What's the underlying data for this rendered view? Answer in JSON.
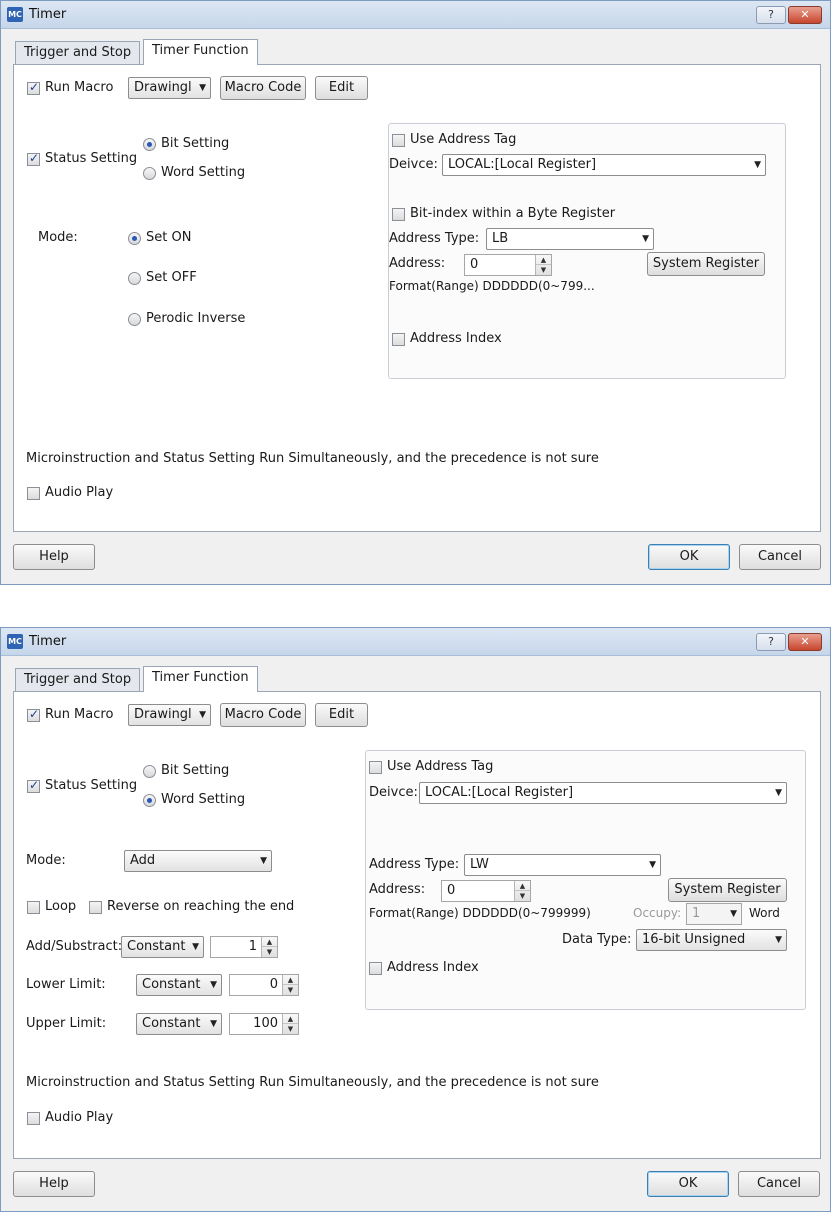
{
  "dialog1": {
    "title": "Timer",
    "help_caption": "?",
    "close_caption": "✕",
    "tabs": [
      "Trigger and Stop",
      "Timer Function"
    ],
    "run_macro": {
      "label": "Run Macro",
      "checked": true,
      "combo": "Drawingl",
      "macro_code": "Macro Code",
      "edit": "Edit"
    },
    "status_setting": {
      "label": "Status Setting",
      "checked": true
    },
    "bit_setting": "Bit Setting",
    "word_setting": "Word Setting",
    "mode_label": "Mode:",
    "modes": [
      "Set ON",
      "Set OFF",
      "Perodic Inverse"
    ],
    "address": {
      "use_address_tag": "Use Address Tag",
      "device_label": "Deivce:",
      "device_value": "LOCAL:[Local Register]",
      "bit_index": "Bit-index within a Byte Register",
      "address_type_label": "Address Type:",
      "address_type_value": "LB",
      "address_label": "Address:",
      "address_value": "0",
      "system_register": "System Register",
      "format": "Format(Range)  DDDDDD(0~799...",
      "address_index": "Address Index"
    },
    "note": "Microinstruction and Status Setting Run Simultaneously, and the precedence is not sure",
    "audio_play": "Audio Play",
    "help": "Help",
    "ok": "OK",
    "cancel": "Cancel"
  },
  "dialog2": {
    "title": "Timer",
    "help_caption": "?",
    "close_caption": "✕",
    "tabs": [
      "Trigger and Stop",
      "Timer Function"
    ],
    "run_macro": {
      "label": "Run Macro",
      "checked": true,
      "combo": "Drawingl",
      "macro_code": "Macro Code",
      "edit": "Edit"
    },
    "status_setting": {
      "label": "Status Setting",
      "checked": true
    },
    "bit_setting": "Bit Setting",
    "word_setting": "Word Setting",
    "mode_label": "Mode:",
    "mode_value": "Add",
    "loop": "Loop",
    "reverse": "Reverse on reaching the end",
    "add_sub": {
      "label": "Add/Substract:",
      "type": "Constant",
      "value": "1"
    },
    "lower": {
      "label": "Lower Limit:",
      "type": "Constant",
      "value": "0"
    },
    "upper": {
      "label": "Upper Limit:",
      "type": "Constant",
      "value": "100"
    },
    "address": {
      "use_address_tag": "Use Address Tag",
      "device_label": "Deivce:",
      "device_value": "LOCAL:[Local Register]",
      "address_type_label": "Address Type:",
      "address_type_value": "LW",
      "address_label": "Address:",
      "address_value": "0",
      "system_register": "System Register",
      "format": "Format(Range)  DDDDDD(0~799999)",
      "occupy_label": "Occupy:",
      "occupy_value": "1",
      "word": "Word",
      "data_type_label": "Data Type:",
      "data_type_value": "16-bit Unsigned",
      "address_index": "Address Index"
    },
    "note": "Microinstruction and Status Setting Run Simultaneously, and the precedence is not sure",
    "audio_play": "Audio Play",
    "help": "Help",
    "ok": "OK",
    "cancel": "Cancel"
  }
}
